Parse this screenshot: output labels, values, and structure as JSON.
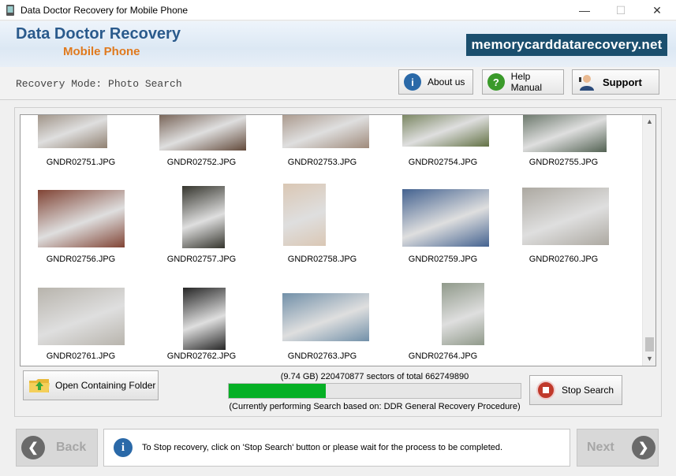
{
  "window": {
    "title": "Data Doctor Recovery for Mobile Phone",
    "controls": {
      "minimize": "—",
      "maximize": "☐",
      "close": "✕"
    }
  },
  "header": {
    "brand_line1": "Data Doctor Recovery",
    "brand_line2": "Mobile Phone",
    "site": "memorycarddatarecovery.net",
    "brand_color": "#2a5a8c",
    "accent_color": "#e07a1e"
  },
  "toolbar": {
    "mode_text": "Recovery Mode: Photo Search",
    "about_label": "About us",
    "help_label": "Help Manual",
    "support_label": "Support",
    "about_icon": "info-icon",
    "help_icon": "question-icon",
    "support_icon": "support-person-icon"
  },
  "gallery": {
    "items": [
      {
        "name": "GNDR02751.JPG",
        "color": "#8a7a6a"
      },
      {
        "name": "GNDR02752.JPG",
        "color": "#5a4030"
      },
      {
        "name": "GNDR02753.JPG",
        "color": "#9a8474"
      },
      {
        "name": "GNDR02754.JPG",
        "color": "#5a6a3a"
      },
      {
        "name": "GNDR02755.JPG",
        "color": "#4a5a4a"
      },
      {
        "name": "GNDR02756.JPG",
        "color": "#7a3a2a"
      },
      {
        "name": "GNDR02757.JPG",
        "color": "#2a2a22"
      },
      {
        "name": "GNDR02758.JPG",
        "color": "#d8c4b0"
      },
      {
        "name": "GNDR02759.JPG",
        "color": "#3a5a8a"
      },
      {
        "name": "GNDR02760.JPG",
        "color": "#a8a49c"
      },
      {
        "name": "GNDR02761.JPG",
        "color": "#b4b0a8"
      },
      {
        "name": "GNDR02762.JPG",
        "color": "#1a1a1a"
      },
      {
        "name": "GNDR02763.JPG",
        "color": "#6a8aa4"
      },
      {
        "name": "GNDR02764.JPG",
        "color": "#8a9484"
      }
    ]
  },
  "actions": {
    "open_folder_label": "Open Containing Folder",
    "stop_label": "Stop Search"
  },
  "progress": {
    "stats": "(9.74 GB) 220470877  sectors  of  total 662749890",
    "fraction": 0.333,
    "status": "(Currently performing Search based on:  DDR General Recovery Procedure)",
    "fill_color": "#06b025"
  },
  "footer": {
    "back_label": "Back",
    "next_label": "Next",
    "info_text": "To Stop recovery, click on 'Stop Search' button or please wait for the process to be completed."
  }
}
